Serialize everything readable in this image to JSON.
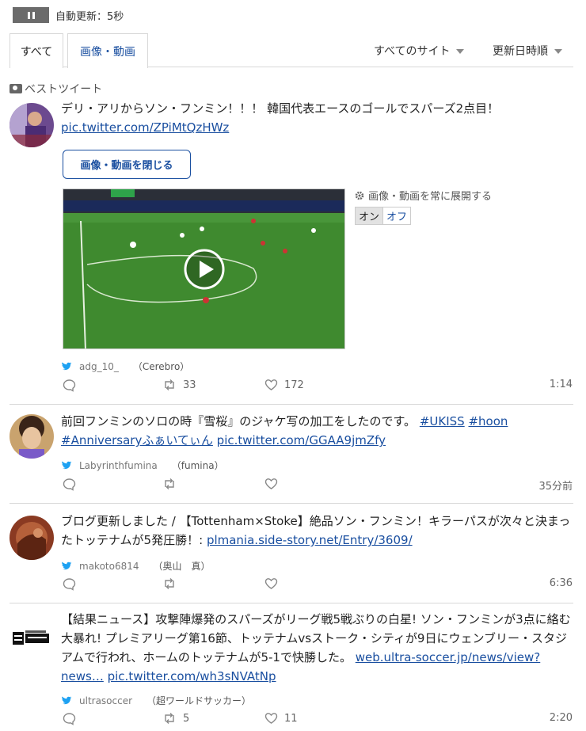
{
  "topbar": {
    "autoupdate": "自動更新：5秒"
  },
  "tabs": {
    "all": "すべて",
    "media": "画像・動画"
  },
  "filters": {
    "sites": "すべてのサイト",
    "sort": "更新日時順"
  },
  "section": {
    "best_label": "ベストツイート"
  },
  "media_controls": {
    "close_label": "画像・動画を閉じる",
    "expand_label": "画像・動画を常に展開する",
    "on_label": "オン",
    "off_label": "オフ"
  },
  "tweets": [
    {
      "text": "デリ・アリからソン・フンミン！！！ 韓国代表エースのゴールでスパーズ2点目！",
      "link": "pic.twitter.com/ZPiMtQzHWz",
      "username": "adg_10_",
      "display_name": "（Cerebro）",
      "retweets": "33",
      "likes": "172",
      "time": "1:14"
    },
    {
      "text_pre": "前回フンミンのソロの時『雪桜』のジャケ写の加工をしたのです。",
      "tag1": "#UKISS",
      "tag2": "#hoon",
      "tag3": "#Anniversaryふぁいてぃん",
      "link": "pic.twitter.com/GGAA9jmZfy",
      "username": "Labyrinthfumina",
      "display_name": "（fumina）",
      "retweets": "",
      "likes": "",
      "time": "35分前"
    },
    {
      "text": "ブログ更新しました / 【Tottenham×Stoke】絶品ソン・フンミン！キラーパスが次々と決まったトッテナムが5発圧勝！:",
      "link": "plmania.side-story.net/Entry/3609/",
      "username": "makoto6814",
      "display_name": "（奥山　真）",
      "retweets": "",
      "likes": "",
      "time": "6:36"
    },
    {
      "text": "【結果ニュース】攻撃陣爆発のスパーズがリーグ戦5戦ぶりの白星! ソン・フンミンが3点に絡む大暴れ! プレミアリーグ第16節、トッテナムvsストーク・シティが9日にウェンブリー・スタジアムで行われ、ホームのトッテナムが5-1で快勝した。",
      "link1": "web.ultra-soccer.jp/news/view?news…",
      "link2": "pic.twitter.com/wh3sNVAtNp",
      "username": "ultrasoccer",
      "display_name": "（超ワールドサッカー）",
      "retweets": "5",
      "likes": "11",
      "time": "2:20"
    }
  ],
  "colors": {
    "link": "#1a4fa0",
    "twitter": "#1da1f2",
    "pitch": "#3a7a2c"
  },
  "icons": [
    "pause-icon",
    "camera-icon",
    "gear-icon",
    "play-icon",
    "twitter-bird-icon",
    "reply-icon",
    "retweet-icon",
    "heart-icon"
  ]
}
